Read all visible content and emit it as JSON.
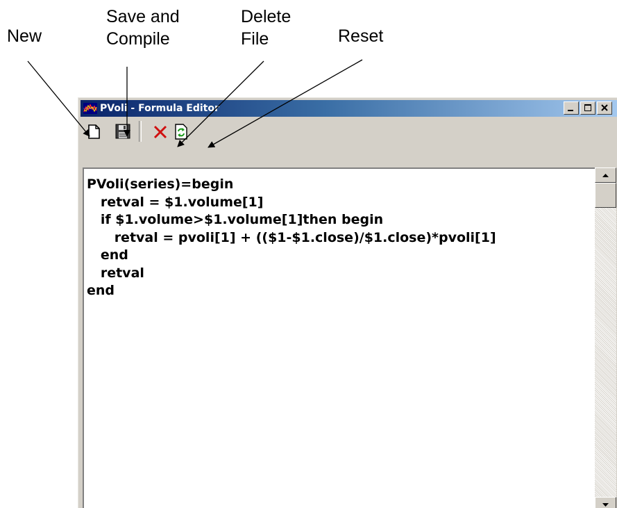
{
  "callouts": {
    "new": "New",
    "save": "Save and\nCompile",
    "delete": "Delete\nFile",
    "reset": "Reset"
  },
  "window": {
    "title": "PVoli - Formula Editor",
    "buttons": [
      "minimize",
      "maximize",
      "close"
    ]
  },
  "toolbar": {
    "items": [
      {
        "name": "new",
        "icon": "new-document-icon"
      },
      {
        "name": "save-and-compile",
        "icon": "floppy-disk-icon"
      },
      {
        "name": "delete-file",
        "icon": "red-x-icon"
      },
      {
        "name": "reset",
        "icon": "refresh-document-icon"
      }
    ]
  },
  "editor": {
    "lines": [
      "PVoli(series)=begin",
      "   retval = $1.volume[1]",
      "   if $1.volume>$1.volume[1]then begin",
      "      retval = pvoli[1] + (($1-$1.close)/$1.close)*pvoli[1]",
      "   end",
      "   retval",
      "end"
    ]
  },
  "colors": {
    "titlebar_start": "#0a246a",
    "titlebar_end": "#a6caf0",
    "window_face": "#d4d0c8"
  }
}
